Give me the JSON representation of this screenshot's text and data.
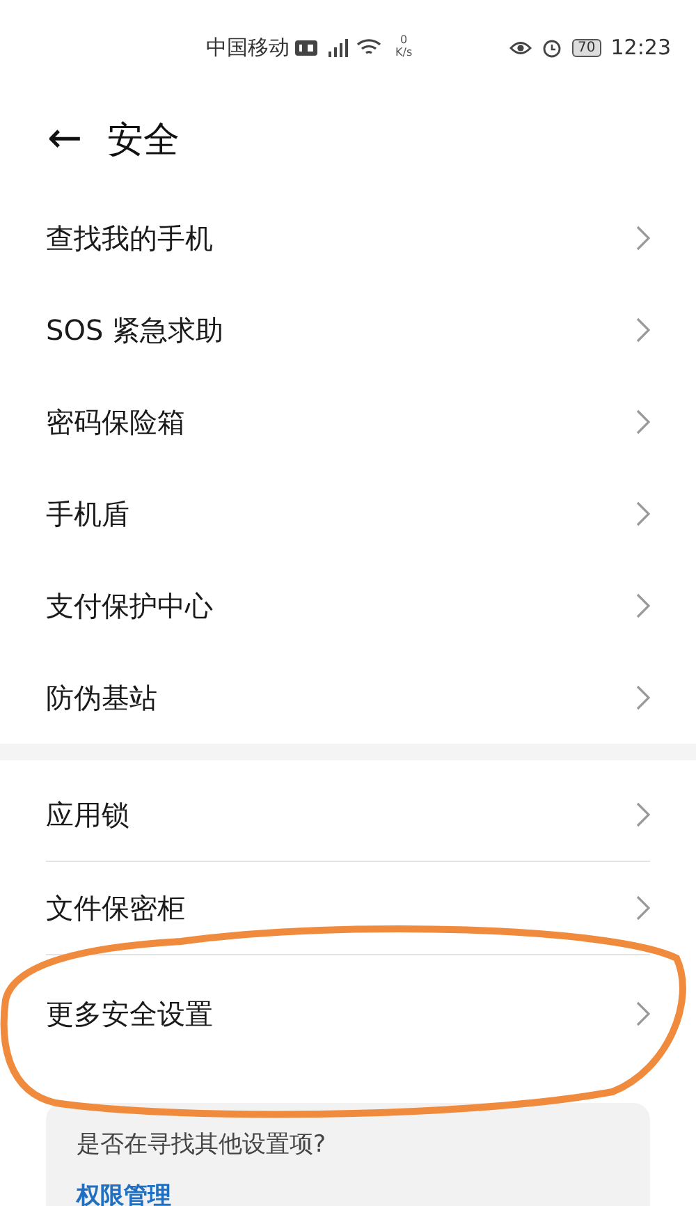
{
  "status_bar": {
    "carrier": "中国移动",
    "network_speed": {
      "value": "0",
      "unit": "K/s"
    },
    "battery": "70",
    "time": "12:23"
  },
  "header": {
    "back_icon": "←",
    "title": "安全"
  },
  "groups": [
    {
      "items": [
        {
          "label": "查找我的手机"
        },
        {
          "label": "SOS 紧急求助"
        },
        {
          "label": "密码保险箱"
        },
        {
          "label": "手机盾"
        },
        {
          "label": "支付保护中心"
        },
        {
          "label": "防伪基站"
        }
      ]
    },
    {
      "items": [
        {
          "label": "应用锁"
        },
        {
          "label": "文件保密柜"
        },
        {
          "label": "更多安全设置",
          "circled": true
        }
      ]
    }
  ],
  "suggestion_card": {
    "question": "是否在寻找其他设置项?",
    "link": "权限管理"
  }
}
